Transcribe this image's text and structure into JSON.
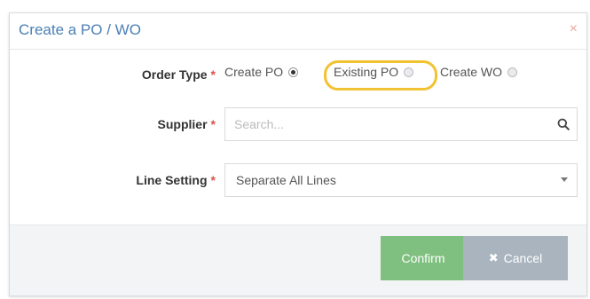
{
  "modal": {
    "title": "Create a PO / WO",
    "close_glyph": "×"
  },
  "order_type": {
    "label": "Order Type",
    "required_mark": "*",
    "options": [
      {
        "label": "Create PO",
        "checked": true
      },
      {
        "label": "Existing PO",
        "checked": false,
        "highlighted": true
      },
      {
        "label": "Create WO",
        "checked": false
      }
    ]
  },
  "supplier": {
    "label": "Supplier",
    "required_mark": "*",
    "placeholder": "Search...",
    "value": "",
    "icon": "search-icon"
  },
  "line_setting": {
    "label": "Line Setting",
    "required_mark": "*",
    "selected": "Separate All Lines",
    "icon": "chevron-down-icon"
  },
  "footer": {
    "confirm_label": "Confirm",
    "cancel_label": "Cancel",
    "cancel_icon": "close-icon"
  },
  "colors": {
    "title": "#4a7fb5",
    "required": "#d9534f",
    "highlight": "#f1c232",
    "confirm": "#7fbf7f",
    "cancel": "#a9b4be"
  }
}
